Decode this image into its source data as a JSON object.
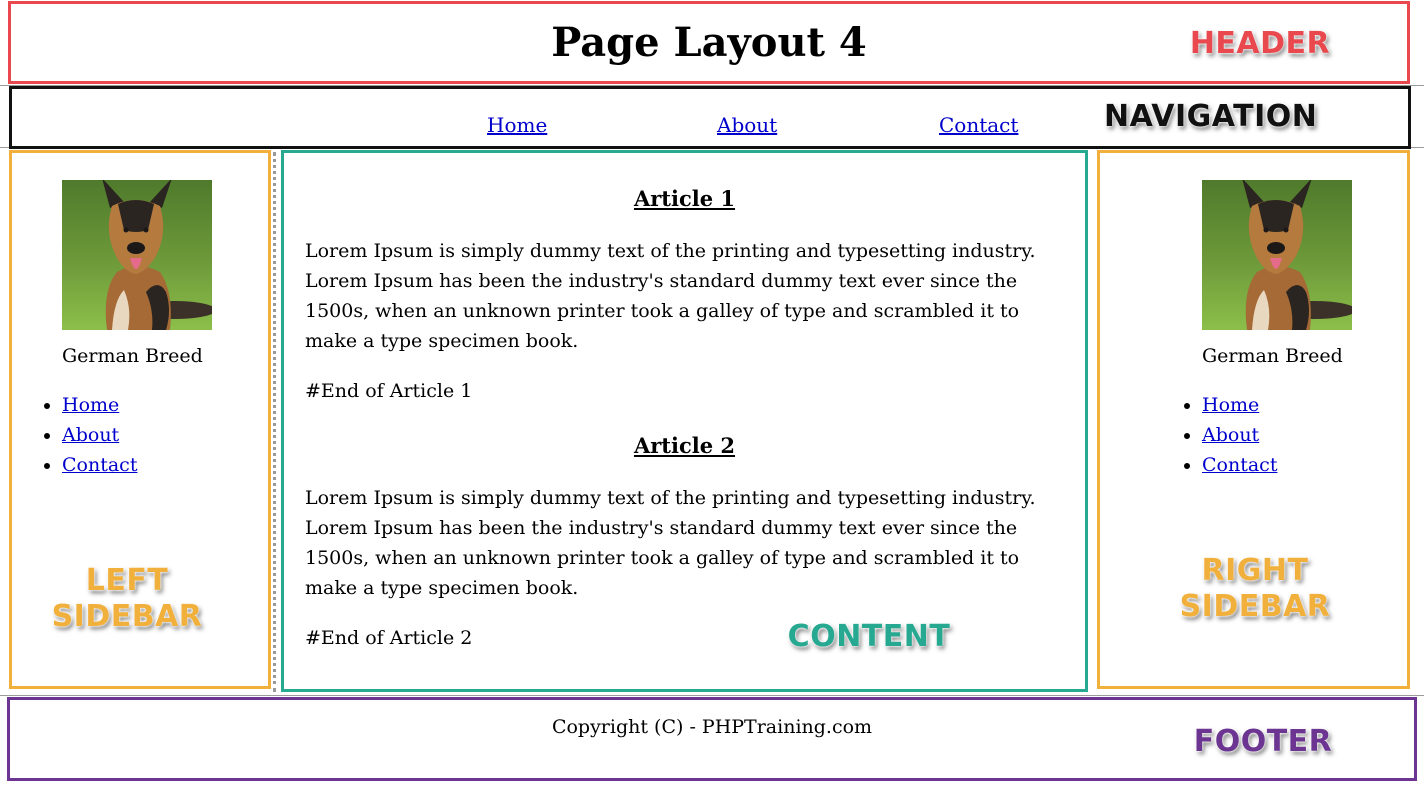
{
  "header": {
    "title": "Page Layout 4",
    "callout": "HEADER"
  },
  "navigation": {
    "callout": "NAVIGATION",
    "links": [
      {
        "label": "Home"
      },
      {
        "label": "About"
      },
      {
        "label": "Contact"
      }
    ]
  },
  "left_sidebar": {
    "image_alt": "German Shepherd dog photo",
    "caption": "German Breed",
    "links": [
      {
        "label": "Home"
      },
      {
        "label": "About"
      },
      {
        "label": "Contact"
      }
    ],
    "callout_line1": "LEFT",
    "callout_line2": "SIDEBAR"
  },
  "right_sidebar": {
    "image_alt": "German Shepherd dog photo",
    "caption": "German Breed",
    "links": [
      {
        "label": "Home"
      },
      {
        "label": "About"
      },
      {
        "label": "Contact"
      }
    ],
    "callout_line1": "RIGHT",
    "callout_line2": "SIDEBAR"
  },
  "content": {
    "callout": "CONTENT",
    "articles": [
      {
        "title": "Article 1",
        "body": "Lorem Ipsum is simply dummy text of the printing and typesetting industry. Lorem Ipsum has been the industry's standard dummy text ever since the 1500s, when an unknown printer took a galley of type and scrambled it to make a type specimen book.",
        "end": "#End of Article 1"
      },
      {
        "title": "Article 2",
        "body": "Lorem Ipsum is simply dummy text of the printing and typesetting industry. Lorem Ipsum has been the industry's standard dummy text ever since the 1500s, when an unknown printer took a galley of type and scrambled it to make a type specimen book.",
        "end": "#End of Article 2"
      }
    ]
  },
  "footer": {
    "copyright": "Copyright (C) - PHPTraining.com",
    "callout": "FOOTER"
  },
  "colors": {
    "header_border": "#e9484f",
    "nav_border": "#111111",
    "sidebar_border": "#f1b03b",
    "content_border": "#26a891",
    "footer_border": "#6b3591",
    "link": "#0000cc"
  }
}
